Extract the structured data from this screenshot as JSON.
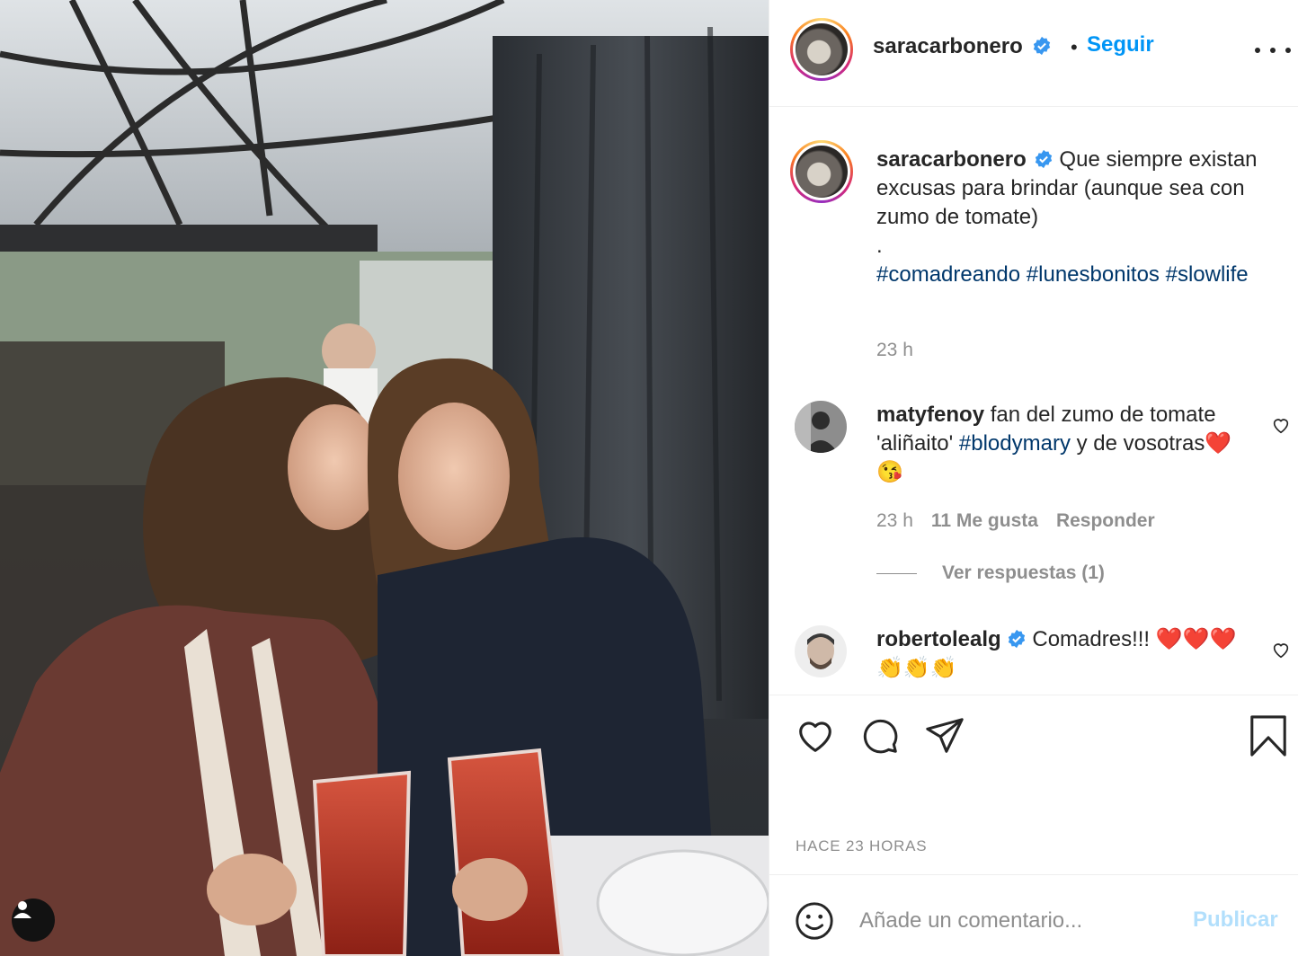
{
  "photo": {
    "alt": "Two women at a restaurant toasting with tomato juice",
    "tag_icon": "user-tag-icon"
  },
  "header": {
    "username": "saracarbonero",
    "separator": "•",
    "follow_label": "Seguir",
    "more_icon": "more-options-icon"
  },
  "caption": {
    "username": "saracarbonero",
    "text_line1": "Que siempre existan excusas para brindar (aunque sea con zumo de tomate)",
    "text_line2": ".",
    "hashtags": [
      "#comadreando",
      "#lunesbonitos",
      "#slowlife"
    ],
    "time": "23 h"
  },
  "comments": [
    {
      "username": "matyfenoy",
      "text_before": "fan del zumo de tomate 'aliñaito'",
      "hashtag": "#blodymary",
      "text_after": "y de vosotras❤️😘",
      "time": "23 h",
      "likes": "11 Me gusta",
      "reply_label": "Responder",
      "view_replies": "Ver respuestas (1)"
    },
    {
      "username": "robertolealg",
      "text": "Comadres!!! ❤️❤️❤️👏👏👏"
    }
  ],
  "actions": {
    "like_icon": "heart-icon",
    "comment_icon": "comment-icon",
    "share_icon": "share-icon",
    "save_icon": "bookmark-icon",
    "time_ago": "HACE 23 HORAS"
  },
  "add_comment": {
    "emoji_icon": "emoji-icon",
    "placeholder": "Añade un comentario...",
    "publish_label": "Publicar"
  },
  "colors": {
    "accent": "#0095f6",
    "hashtag": "#00376b",
    "muted": "#8e8e8e",
    "publish_disabled": "#b2dffc",
    "verified": "#3897f0"
  }
}
